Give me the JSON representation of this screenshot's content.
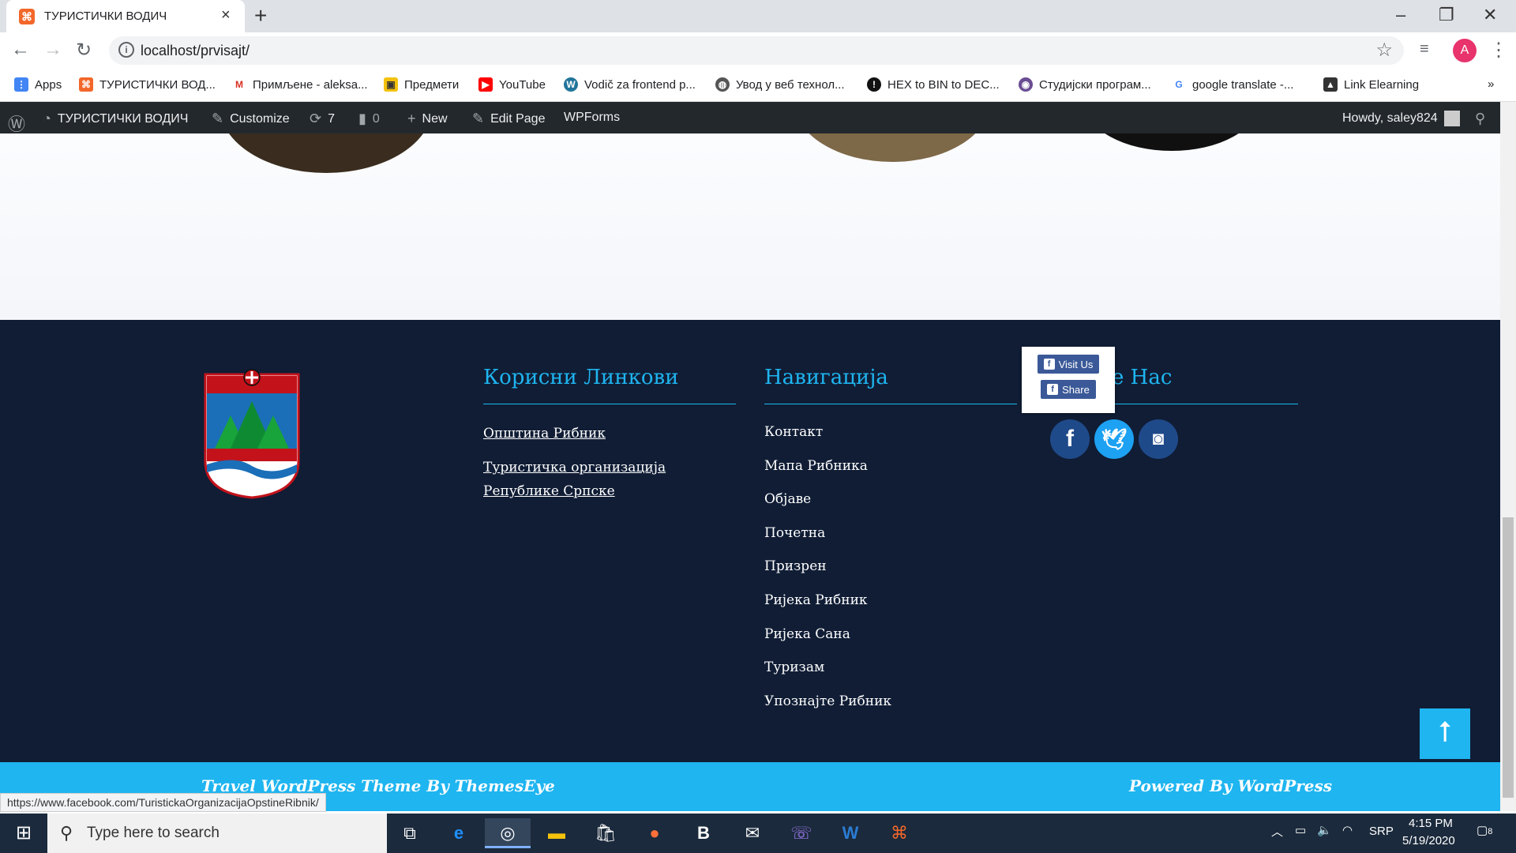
{
  "browser": {
    "tab_title": "ТУРИСТИЧКИ ВОДИЧ",
    "url": "localhost/prvisajt/",
    "profile_initial": "A",
    "bookmarks": [
      "Apps",
      "ТУРИСТИЧКИ ВОД...",
      "Примљене - aleksa...",
      "Предмети",
      "YouTube",
      "Vodič za frontend p...",
      "Увод у веб технол...",
      "HEX to BIN to DEC...",
      "Студијски програм...",
      "google translate -...",
      "Link Elearning"
    ],
    "overflow": "»"
  },
  "adminbar": {
    "site": "ТУРИСТИЧКИ ВОДИЧ",
    "customize": "Customize",
    "updates": "7",
    "comments": "0",
    "new": "New",
    "edit": "Edit Page",
    "wpforms": "WPForms",
    "howdy": "Howdy, saley824"
  },
  "footer": {
    "col1_heading": "Корисни Линкови",
    "col1_links": [
      "Општина Рибник",
      "Туристичка организација Републике Српске"
    ],
    "col2_heading": "Навигација",
    "col2_links": [
      "Контакт",
      "Мапа Рибника",
      "Објаве",
      "Почетна",
      "Призрен",
      "Ријека Рибник",
      "Ријека Сана",
      "Туризам",
      "Упознајте Рибник"
    ],
    "col3_heading_visible": "e Нас",
    "popup_visit": "Visit Us",
    "popup_share": "Share",
    "credit_left": "Travel WordPress Theme By ThemesEye",
    "credit_right": "Powered By WordPress"
  },
  "status_url": "https://www.facebook.com/TuristickaOrganizacijaOpstineRibnik/",
  "taskbar": {
    "search_placeholder": "Type here to search",
    "lang": "SRP",
    "time": "4:15 PM",
    "date": "5/19/2020",
    "notifications": "8"
  },
  "colors": {
    "footer_bg": "#101d35",
    "accent": "#1fb5f0",
    "admin_bar": "#23282d"
  }
}
